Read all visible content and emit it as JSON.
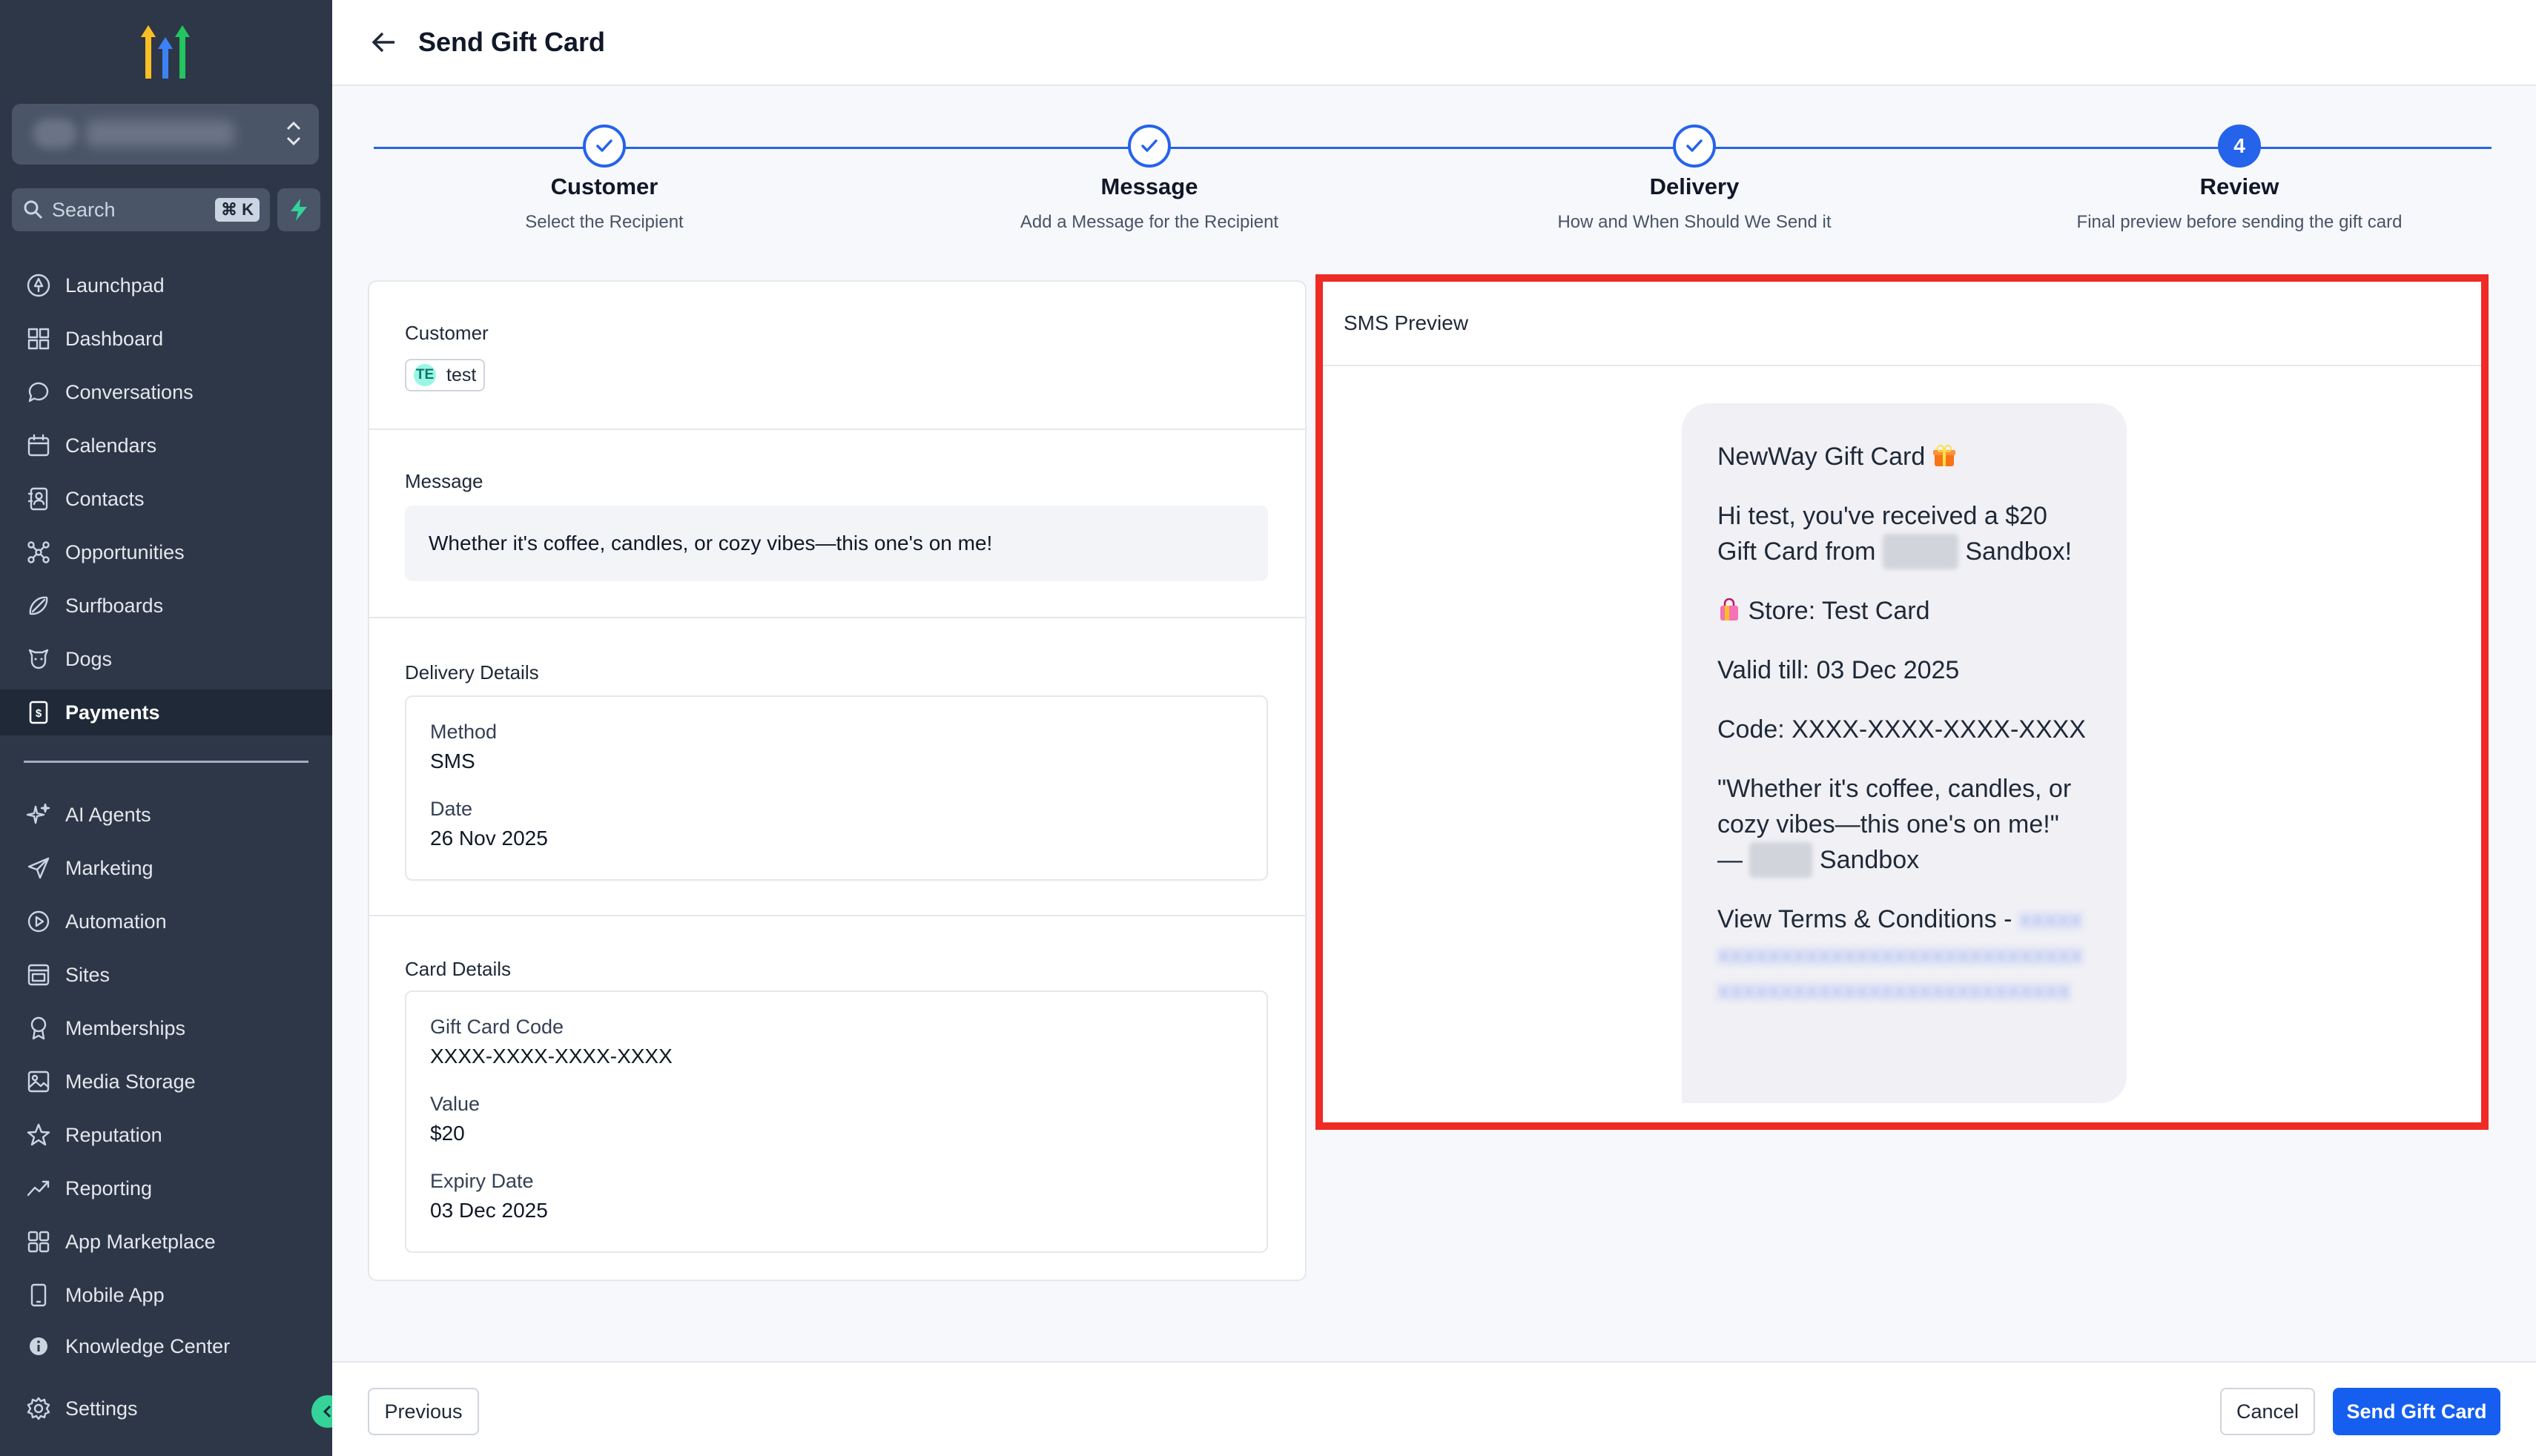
{
  "sidebar": {
    "search_placeholder": "Search",
    "search_shortcut": "⌘ K",
    "items": [
      {
        "label": "Launchpad",
        "icon": "rocket-icon"
      },
      {
        "label": "Dashboard",
        "icon": "grid-icon"
      },
      {
        "label": "Conversations",
        "icon": "chat-icon"
      },
      {
        "label": "Calendars",
        "icon": "calendar-icon"
      },
      {
        "label": "Contacts",
        "icon": "contacts-icon"
      },
      {
        "label": "Opportunities",
        "icon": "network-icon"
      },
      {
        "label": "Surfboards",
        "icon": "surfboard-icon"
      },
      {
        "label": "Dogs",
        "icon": "dog-icon"
      },
      {
        "label": "Payments",
        "icon": "payments-icon"
      }
    ],
    "items2": [
      {
        "label": "AI Agents",
        "icon": "sparkle-icon"
      },
      {
        "label": "Marketing",
        "icon": "send-icon"
      },
      {
        "label": "Automation",
        "icon": "automation-icon"
      },
      {
        "label": "Sites",
        "icon": "sites-icon"
      },
      {
        "label": "Memberships",
        "icon": "award-icon"
      },
      {
        "label": "Media Storage",
        "icon": "image-icon"
      },
      {
        "label": "Reputation",
        "icon": "star-icon"
      },
      {
        "label": "Reporting",
        "icon": "trend-icon"
      },
      {
        "label": "App Marketplace",
        "icon": "apps-icon"
      },
      {
        "label": "Mobile App",
        "icon": "phone-icon"
      },
      {
        "label": "Knowledge Center",
        "icon": "info-icon"
      },
      {
        "label": "Settings",
        "icon": "gear-icon"
      }
    ],
    "active_label": "Payments"
  },
  "header": {
    "title": "Send Gift Card"
  },
  "stepper": [
    {
      "title": "Customer",
      "subtitle": "Select the Recipient",
      "state": "done"
    },
    {
      "title": "Message",
      "subtitle": "Add a Message for the Recipient",
      "state": "done"
    },
    {
      "title": "Delivery",
      "subtitle": "How and When Should We Send it",
      "state": "done"
    },
    {
      "title": "Review",
      "subtitle": "Final preview before sending the gift card",
      "state": "current",
      "number": "4"
    }
  ],
  "review": {
    "customer": {
      "label": "Customer",
      "initials": "TE",
      "name": "test"
    },
    "message": {
      "label": "Message",
      "text": "Whether it's coffee, candles, or cozy vibes—this one's on me!"
    },
    "delivery": {
      "label": "Delivery Details",
      "method_label": "Method",
      "method": "SMS",
      "date_label": "Date",
      "date": "26 Nov 2025"
    },
    "card": {
      "label": "Card Details",
      "code_label": "Gift Card Code",
      "code": "XXXX-XXXX-XXXX-XXXX",
      "value_label": "Value",
      "value": "$20",
      "expiry_label": "Expiry Date",
      "expiry": "03 Dec 2025"
    }
  },
  "sms_preview": {
    "title": "SMS Preview",
    "brand_line": "NewWay Gift Card",
    "greeting_a": "Hi test, you've received a $20 Gift Card from ",
    "greeting_b": " Sandbox!",
    "store": "Store: Test Card",
    "valid": "Valid till: 03 Dec 2025",
    "code": "Code: XXXX-XXXX-XXXX-XXXX",
    "quote": "\"Whether it's coffee, candles, or cozy vibes—this one's on me!\"",
    "signoff_a": "— ",
    "signoff_b": " Sandbox",
    "terms": "View Terms & Conditions - "
  },
  "footer": {
    "previous": "Previous",
    "cancel": "Cancel",
    "send": "Send Gift Card"
  },
  "colors": {
    "accent": "#2563eb",
    "highlight": "#ee2b24",
    "sidebar": "#2d3748"
  }
}
